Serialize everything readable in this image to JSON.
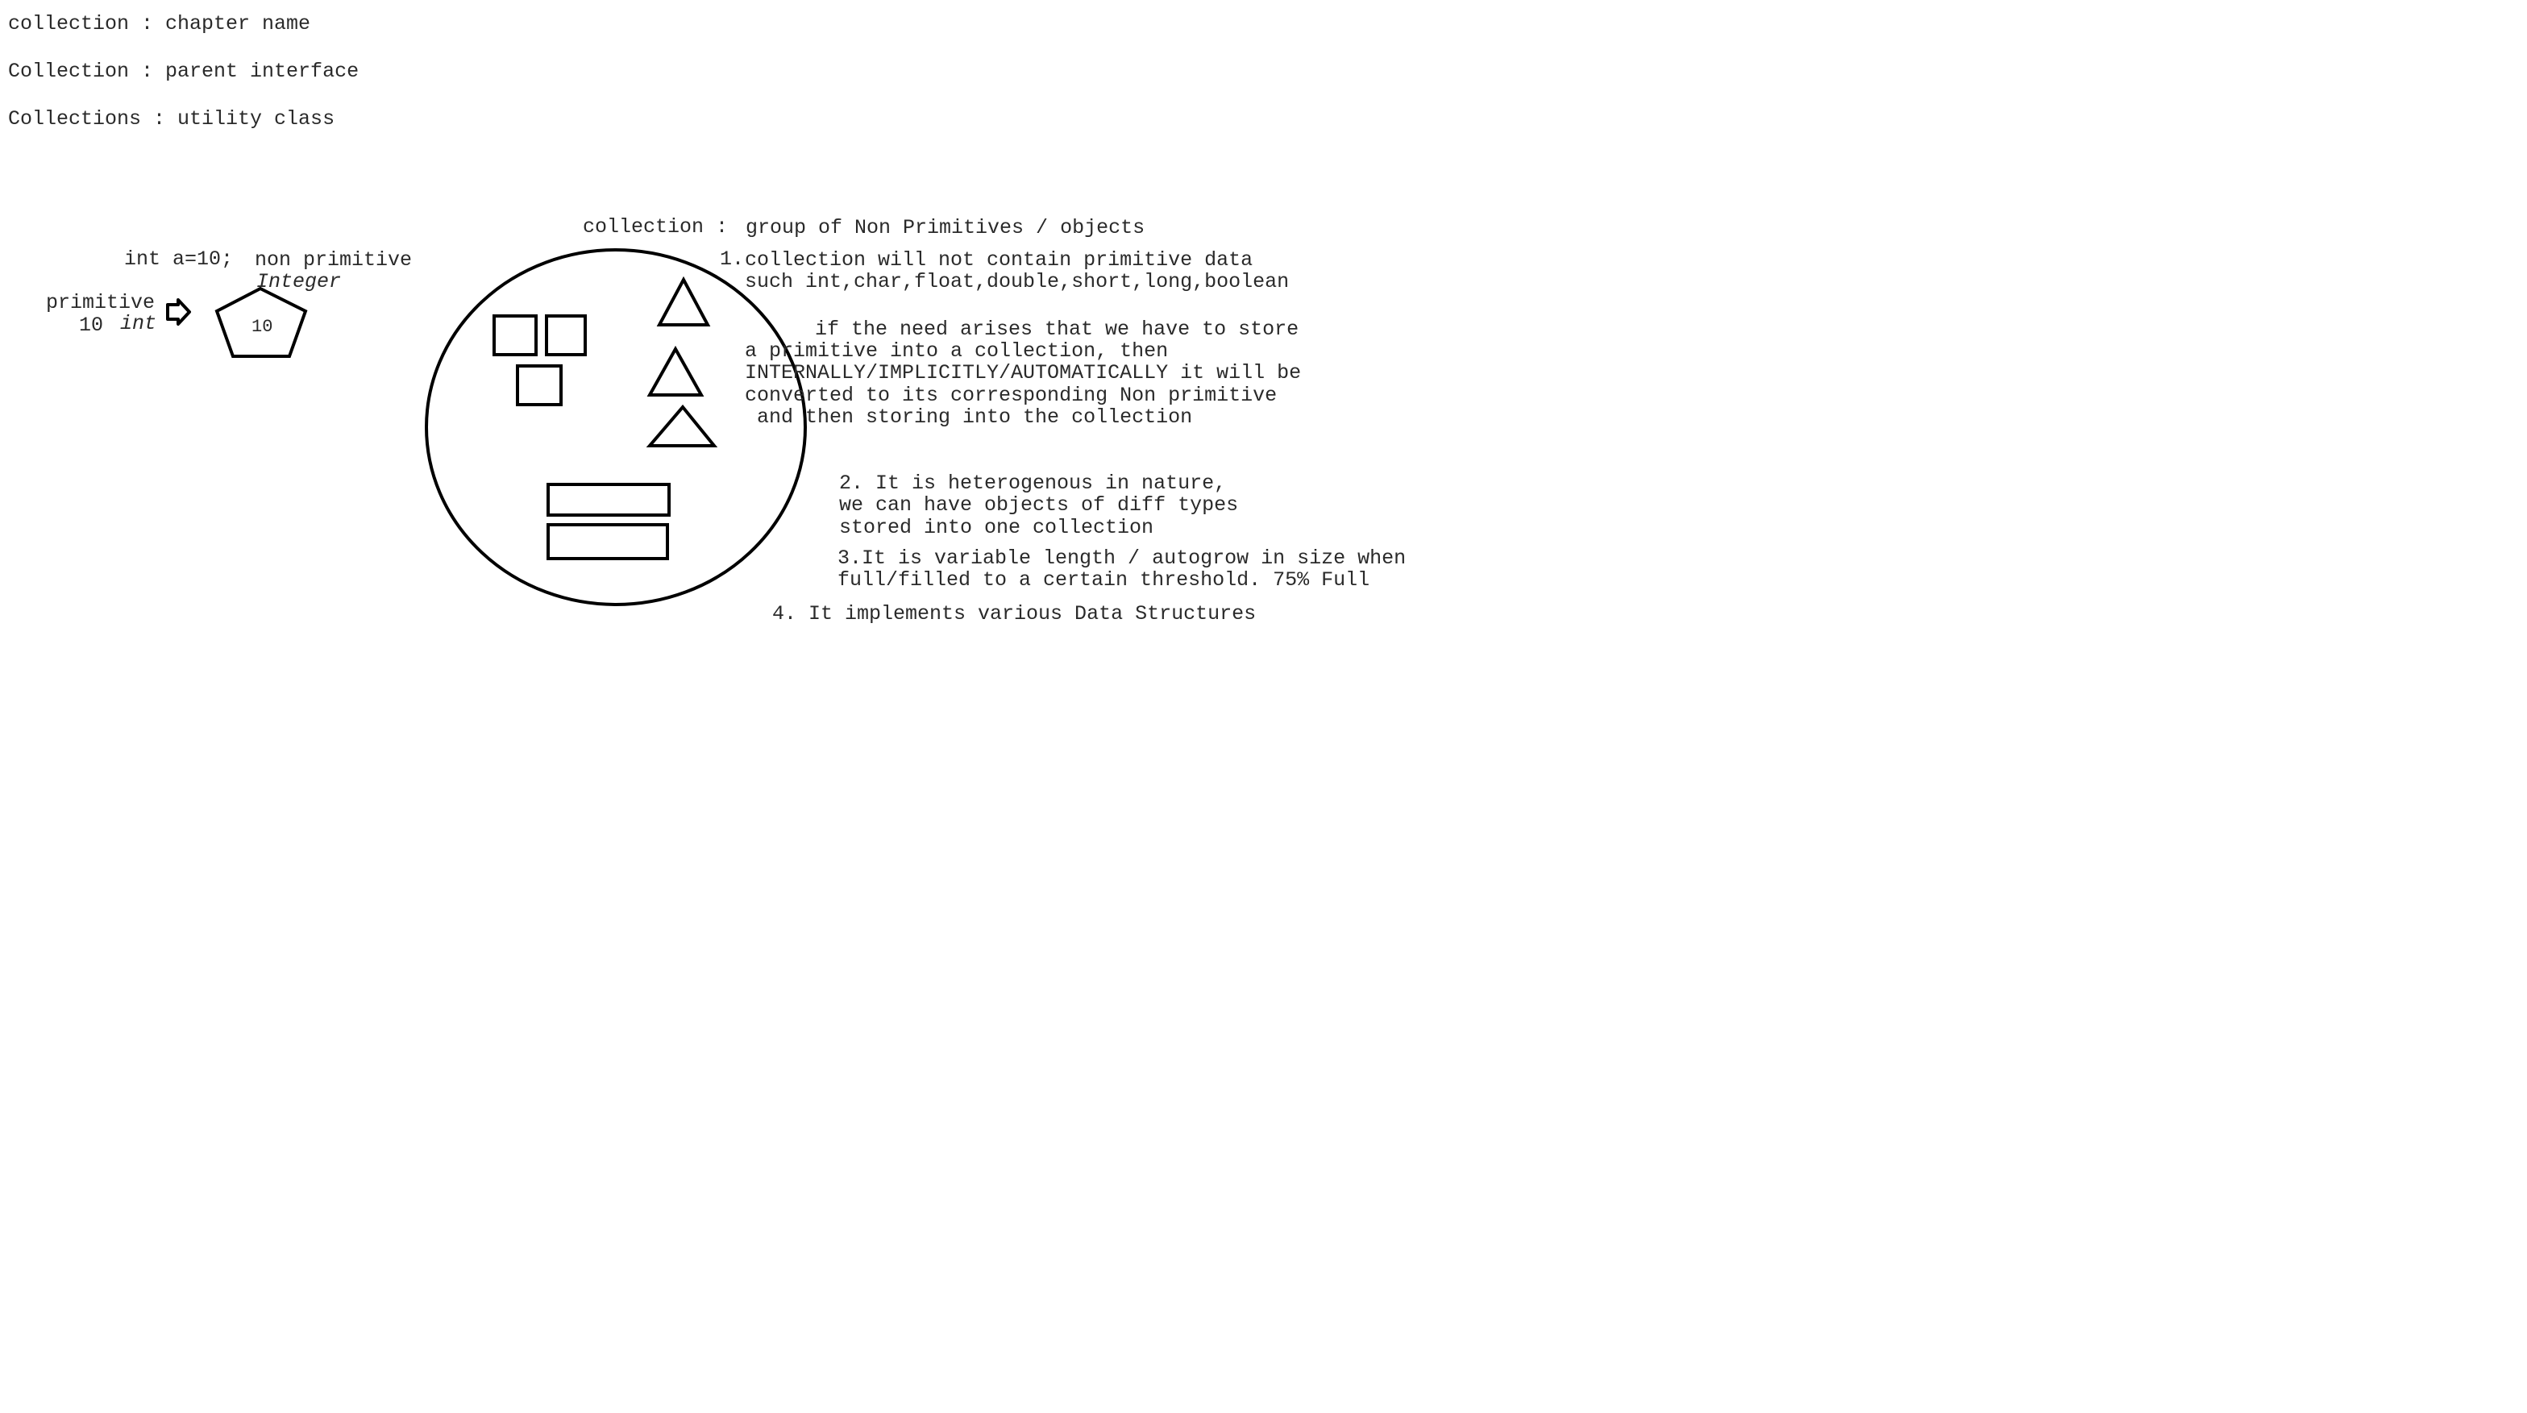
{
  "definitions": [
    "collection : chapter name",
    "Collection : parent interface",
    "Collections : utility class"
  ],
  "left_example": {
    "code_label": "int a=10;",
    "non_primitive_label": "non primitive",
    "wrapper_class": "Integer",
    "primitive_label": "primitive",
    "primitive_value": "10",
    "primitive_type": "int",
    "object_value": "10",
    "arrow_icon": "right-arrow-icon"
  },
  "collection_definition": {
    "term": "collection :",
    "meaning": "group of Non Primitives / objects"
  },
  "points": {
    "p1_number": "1.",
    "p1_lines": [
      "collection will  not contain primitive data",
      "such int,char,float,double,short,long,boolean"
    ],
    "p1_extra_lines": [
      "if the need arises that we have to store",
      "a primitive into a collection, then",
      "INTERNALLY/IMPLICITLY/AUTOMATICALLY it will be",
      "converted to its corresponding Non primitive",
      " and then storing into the collection"
    ],
    "p2_lines": [
      "2. It is heterogenous in nature,",
      "we can have objects of diff types",
      "stored into one collection"
    ],
    "p3_lines": [
      "3.It is variable length / autogrow in size when",
      "full/filled to a certain threshold. 75% Full"
    ],
    "p4_line": "4. It implements various Data Structures"
  },
  "colors": {
    "text": "#2a2a2a",
    "stroke": "#000000",
    "background": "#ffffff"
  }
}
